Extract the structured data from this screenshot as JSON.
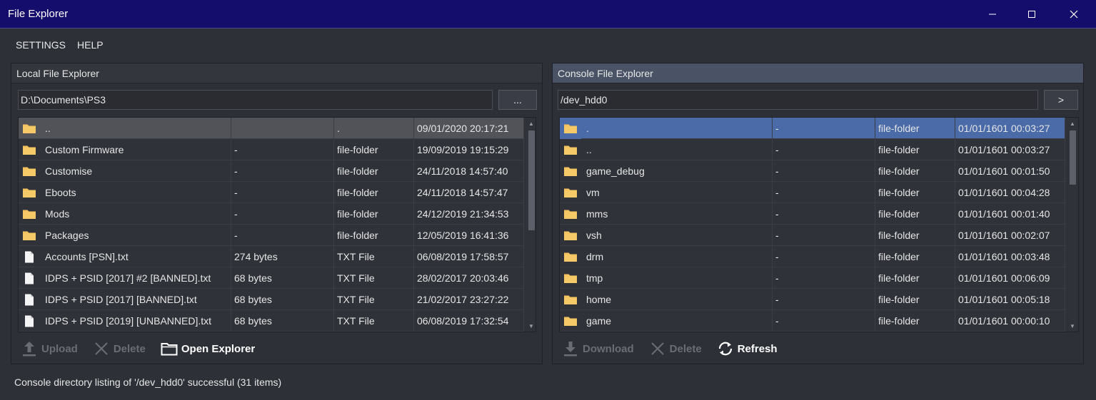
{
  "window": {
    "title": "File Explorer"
  },
  "menu": {
    "items": [
      "SETTINGS",
      "HELP"
    ]
  },
  "local": {
    "header": "Local File Explorer",
    "path": "D:\\Documents\\PS3",
    "browse_label": "...",
    "rows": [
      {
        "icon": "folder-icon",
        "name": "..",
        "size": "",
        "type": ".",
        "date": "09/01/2020 20:17:21",
        "selected": true
      },
      {
        "icon": "folder-icon",
        "name": "Custom Firmware",
        "size": "-",
        "type": "file-folder",
        "date": "19/09/2019 19:15:29"
      },
      {
        "icon": "folder-icon",
        "name": "Customise",
        "size": "-",
        "type": "file-folder",
        "date": "24/11/2018 14:57:40"
      },
      {
        "icon": "folder-icon",
        "name": "Eboots",
        "size": "-",
        "type": "file-folder",
        "date": "24/11/2018 14:57:47"
      },
      {
        "icon": "folder-icon",
        "name": "Mods",
        "size": "-",
        "type": "file-folder",
        "date": "24/12/2019 21:34:53"
      },
      {
        "icon": "folder-icon",
        "name": "Packages",
        "size": "-",
        "type": "file-folder",
        "date": "12/05/2019 16:41:36"
      },
      {
        "icon": "file-icon",
        "name": "Accounts [PSN].txt",
        "size": "274 bytes",
        "type": "TXT File",
        "date": "06/08/2019 17:58:57"
      },
      {
        "icon": "file-icon",
        "name": "IDPS + PSID [2017] #2 [BANNED].txt",
        "size": "68 bytes",
        "type": "TXT File",
        "date": "28/02/2017 20:03:46"
      },
      {
        "icon": "file-icon",
        "name": "IDPS + PSID [2017] [BANNED].txt",
        "size": "68 bytes",
        "type": "TXT File",
        "date": "21/02/2017 23:27:22"
      },
      {
        "icon": "file-icon",
        "name": "IDPS + PSID [2019] [UNBANNED].txt",
        "size": "68 bytes",
        "type": "TXT File",
        "date": "06/08/2019 17:32:54"
      }
    ],
    "actions": [
      {
        "icon": "upload-icon",
        "label": "Upload",
        "enabled": false
      },
      {
        "icon": "delete-icon",
        "label": "Delete",
        "enabled": false
      },
      {
        "icon": "folder-open-icon",
        "label": "Open Explorer",
        "enabled": true
      }
    ]
  },
  "console": {
    "header": "Console File Explorer",
    "path": "/dev_hdd0",
    "go_label": ">",
    "rows": [
      {
        "icon": "folder-icon",
        "name": ".",
        "size": "-",
        "type": "file-folder",
        "date": "01/01/1601 00:03:27",
        "selected": true
      },
      {
        "icon": "folder-icon",
        "name": "..",
        "size": "-",
        "type": "file-folder",
        "date": "01/01/1601 00:03:27"
      },
      {
        "icon": "folder-icon",
        "name": "game_debug",
        "size": "-",
        "type": "file-folder",
        "date": "01/01/1601 00:01:50"
      },
      {
        "icon": "folder-icon",
        "name": "vm",
        "size": "-",
        "type": "file-folder",
        "date": "01/01/1601 00:04:28"
      },
      {
        "icon": "folder-icon",
        "name": "mms",
        "size": "-",
        "type": "file-folder",
        "date": "01/01/1601 00:01:40"
      },
      {
        "icon": "folder-icon",
        "name": "vsh",
        "size": "-",
        "type": "file-folder",
        "date": "01/01/1601 00:02:07"
      },
      {
        "icon": "folder-icon",
        "name": "drm",
        "size": "-",
        "type": "file-folder",
        "date": "01/01/1601 00:03:48"
      },
      {
        "icon": "folder-icon",
        "name": "tmp",
        "size": "-",
        "type": "file-folder",
        "date": "01/01/1601 00:06:09"
      },
      {
        "icon": "folder-icon",
        "name": "home",
        "size": "-",
        "type": "file-folder",
        "date": "01/01/1601 00:05:18"
      },
      {
        "icon": "folder-icon",
        "name": "game",
        "size": "-",
        "type": "file-folder",
        "date": "01/01/1601 00:00:10"
      }
    ],
    "actions": [
      {
        "icon": "download-icon",
        "label": "Download",
        "enabled": false
      },
      {
        "icon": "delete-icon",
        "label": "Delete",
        "enabled": false
      },
      {
        "icon": "refresh-icon",
        "label": "Refresh",
        "enabled": true
      }
    ]
  },
  "status": "Console directory listing of '/dev_hdd0' successful (31 items)",
  "colors": {
    "titlebar": "#150d6b",
    "background": "#2d3037",
    "selection_local": "#515359",
    "selection_console": "#4a6aa8",
    "folder": "#f3c25e"
  }
}
